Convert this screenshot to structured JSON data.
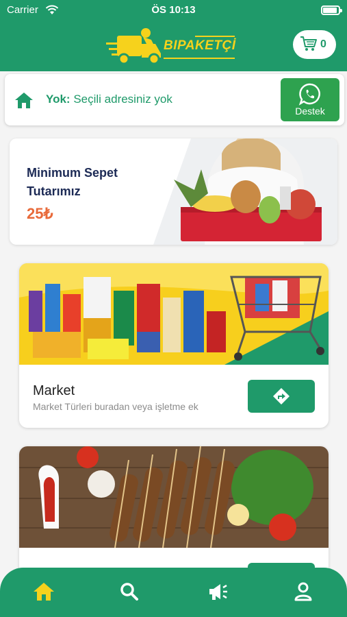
{
  "status_bar": {
    "carrier": "Carrier",
    "time": "ÖS 10:13"
  },
  "header": {
    "logo_text": "BIPAKETÇİ",
    "cart_count": "0"
  },
  "address": {
    "label": "Yok:",
    "text": "Seçili adresiniz yok",
    "support_label": "Destek"
  },
  "promo": {
    "title_line1": "Minimum Sepet",
    "title_line2": "Tutarımız",
    "amount": "25₺"
  },
  "categories": [
    {
      "title": "Market",
      "description": "Market Türleri buradan veya işletme ek"
    },
    {
      "title": "",
      "description": ""
    }
  ],
  "nav": {
    "items": [
      "home-icon",
      "search-icon",
      "megaphone-icon",
      "profile-icon"
    ],
    "active": "home-icon"
  },
  "colors": {
    "primary": "#1f9a6a",
    "accent_yellow": "#f6d21c",
    "price_orange": "#e86a3a",
    "whatsapp_green": "#2ea24f"
  }
}
